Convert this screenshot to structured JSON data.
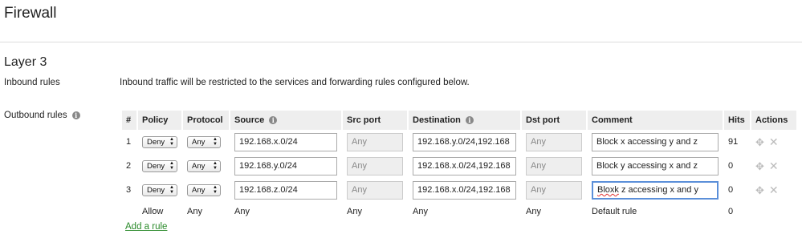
{
  "page": {
    "title": "Firewall"
  },
  "section": {
    "title": "Layer 3"
  },
  "inbound": {
    "label": "Inbound rules",
    "description": "Inbound traffic will be restricted to the services and forwarding rules configured below."
  },
  "outbound": {
    "label": "Outbound rules",
    "columns": {
      "num": "#",
      "policy": "Policy",
      "protocol": "Protocol",
      "source": "Source",
      "src_port": "Src port",
      "destination": "Destination",
      "dst_port": "Dst port",
      "comment": "Comment",
      "hits": "Hits",
      "actions": "Actions"
    },
    "rules": [
      {
        "num": "1",
        "policy": "Deny",
        "protocol": "Any",
        "source": "192.168.x.0/24",
        "src_port": "Any",
        "destination": "192.168.y.0/24,192.168",
        "dst_port": "Any",
        "comment": "Block x accessing y and z",
        "hits": "91"
      },
      {
        "num": "2",
        "policy": "Deny",
        "protocol": "Any",
        "source": "192.168.y.0/24",
        "src_port": "Any",
        "destination": "192.168.x.0/24,192.168",
        "dst_port": "Any",
        "comment": "Block y accessing x and z",
        "hits": "0"
      },
      {
        "num": "3",
        "policy": "Deny",
        "protocol": "Any",
        "source": "192.168.z.0/24",
        "src_port": "Any",
        "destination": "192.168.x.0/24,192.168",
        "dst_port": "Any",
        "comment_first_word": "Bloxk",
        "comment_rest": " z accessing x and y",
        "hits": "0"
      }
    ],
    "default_rule": {
      "policy": "Allow",
      "protocol": "Any",
      "source": "Any",
      "src_port": "Any",
      "destination": "Any",
      "dst_port": "Any",
      "comment": "Default rule",
      "hits": "0"
    },
    "add_rule_label": "Add a rule"
  },
  "icons": {
    "info": "info-icon",
    "select_arrows": "up-down-arrows-icon",
    "move": "move-icon",
    "delete": "close-icon"
  },
  "colors": {
    "link": "#2a8a2a",
    "focus_border": "#5b8fd9",
    "header_bg": "#eeeeee",
    "spellcheck": "#e03030"
  }
}
